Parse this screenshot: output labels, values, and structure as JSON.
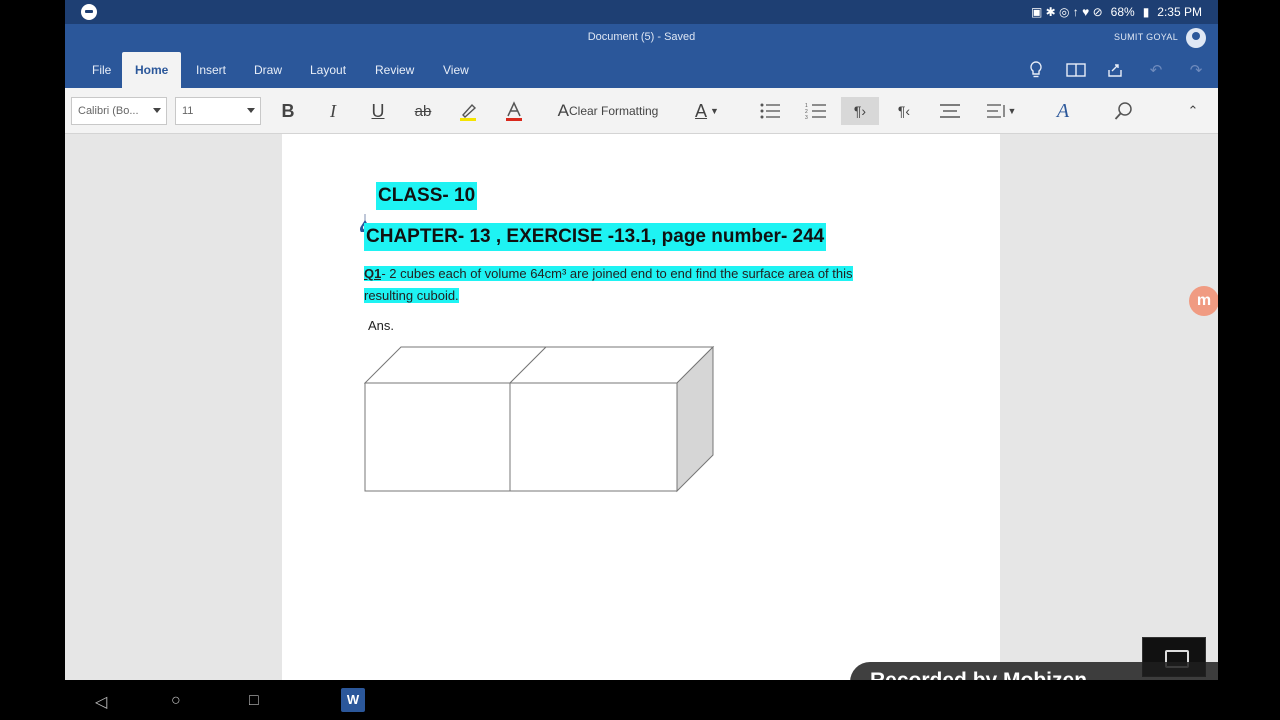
{
  "status_bar": {
    "battery": "68%",
    "time": "2:35 PM"
  },
  "title_bar": {
    "document_title": "Document (5) - Saved",
    "user_name": "SUMIT GOYAL"
  },
  "ribbon": {
    "tabs": [
      {
        "label": "File"
      },
      {
        "label": "Home",
        "active": true
      },
      {
        "label": "Insert"
      },
      {
        "label": "Draw"
      },
      {
        "label": "Layout"
      },
      {
        "label": "Review"
      },
      {
        "label": "View"
      }
    ]
  },
  "toolbar": {
    "font_name": "Calibri (Bo...",
    "font_size": "11",
    "bold_label": "B",
    "italic_label": "I",
    "underline_label": "U",
    "strike_label": "ab",
    "clear_formatting_label": "Clear Formatting",
    "font_color_label": "A"
  },
  "document": {
    "class_line": "CLASS- 10",
    "chapter_line": "CHAPTER- 13 , EXERCISE -13.1, page number- 244",
    "question_prefix": "Q1",
    "question_text": "- 2 cubes each of volume 64cm³ are joined end to end find the surface area of this resulting cuboid.",
    "answer_label": "Ans."
  },
  "watermark": {
    "text": "Recorded by Mobizen"
  },
  "colors": {
    "ribbon_blue": "#2b579a",
    "highlight": "#1ef3f3"
  },
  "icons": [
    "lightbulb-icon",
    "reader-icon",
    "share-icon",
    "undo-icon",
    "redo-icon",
    "search-icon"
  ]
}
